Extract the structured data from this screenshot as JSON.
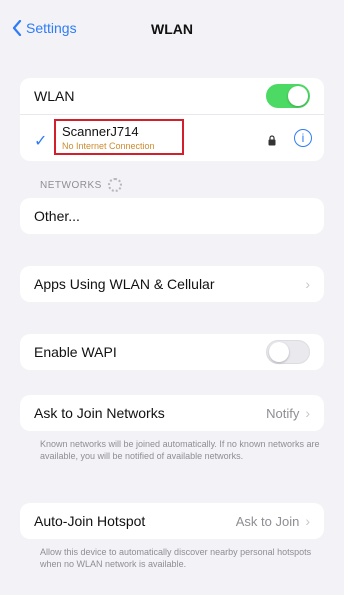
{
  "nav": {
    "back_label": "Settings",
    "title": "WLAN"
  },
  "wlan": {
    "label": "WLAN",
    "toggle_state": "on",
    "current_network": {
      "name": "ScannerJ714",
      "status": "No Internet Connection"
    }
  },
  "networks": {
    "header": "NETWORKS",
    "other_label": "Other..."
  },
  "apps_using": {
    "label": "Apps Using WLAN & Cellular"
  },
  "wapi": {
    "label": "Enable WAPI",
    "toggle_state": "off"
  },
  "ask_to_join": {
    "label": "Ask to Join Networks",
    "value": "Notify",
    "note": "Known networks will be joined automatically. If no known networks are available, you will be notified of available networks."
  },
  "auto_join": {
    "label": "Auto-Join Hotspot",
    "value": "Ask to Join",
    "note": "Allow this device to automatically discover nearby personal hotspots when no WLAN network is available."
  },
  "colors": {
    "accent": "#2f7cf6",
    "toggle_on": "#4cd964",
    "highlight_box": "#d21f2b"
  }
}
